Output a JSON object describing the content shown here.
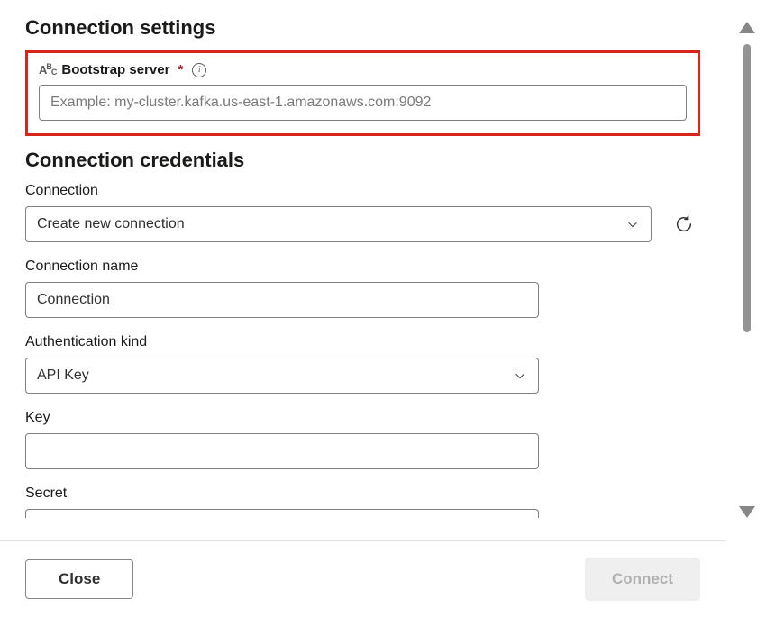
{
  "sections": {
    "connection_settings_title": "Connection settings",
    "connection_credentials_title": "Connection credentials"
  },
  "bootstrap_server": {
    "type_indicator": "ABC",
    "label": "Bootstrap server",
    "required_mark": "*",
    "info_glyph": "i",
    "placeholder": "Example: my-cluster.kafka.us-east-1.amazonaws.com:9092",
    "value": ""
  },
  "connection": {
    "label": "Connection",
    "selected": "Create new connection",
    "options": [
      "Create new connection"
    ]
  },
  "connection_name": {
    "label": "Connection name",
    "value": "Connection"
  },
  "authentication_kind": {
    "label": "Authentication kind",
    "selected": "API Key",
    "options": [
      "API Key"
    ]
  },
  "key": {
    "label": "Key",
    "value": ""
  },
  "secret": {
    "label": "Secret",
    "value": ""
  },
  "footer": {
    "close_label": "Close",
    "connect_label": "Connect"
  },
  "icons": {
    "refresh": "refresh",
    "chevron_down": "chevron-down",
    "info": "info"
  }
}
